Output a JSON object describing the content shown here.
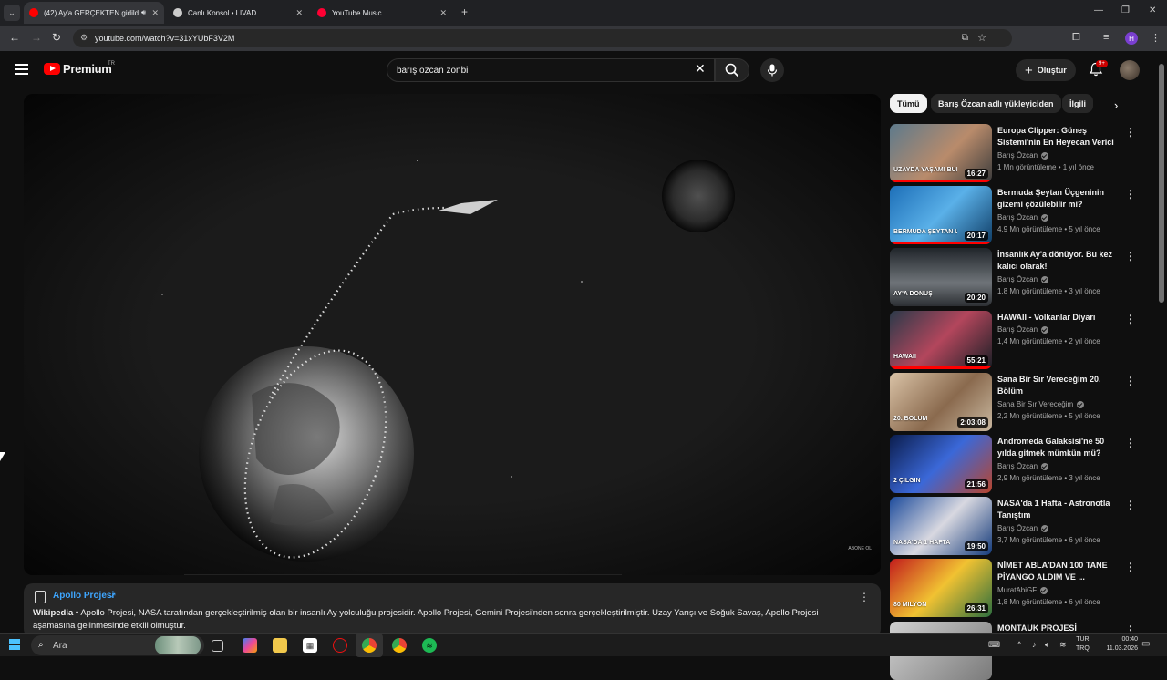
{
  "browser": {
    "tabs": [
      {
        "label": "(42) Ay'a GERÇEKTEN gidild",
        "active": true,
        "favicon_color": "#ff0000"
      },
      {
        "label": "Canlı Konsol • LIVAD",
        "active": false,
        "favicon_color": "#cccccc"
      },
      {
        "label": "YouTube Music",
        "active": false,
        "favicon_color": "#ff0033"
      }
    ],
    "url": "youtube.com/watch?v=31xYUbF3V2M"
  },
  "header": {
    "logo_text": "Premium",
    "country_code": "TR",
    "search_value": "barış özcan zonbi",
    "create_label": "Oluştur",
    "notification_badge": "9+"
  },
  "player": {
    "watermark": "ABONE OL"
  },
  "info_card": {
    "title": "Apollo Projesi",
    "source": "Wikipedia",
    "text": " • Apollo Projesi, NASA tarafından gerçekleştirilmiş olan bir insanlı Ay yolculuğu projesidir. Apollo Projesi, Gemini Projesi'nden sonra gerçekleştirilmiştir. Uzay Yarışı ve Soğuk Savaş, Apollo Projesi aşamasına gelinmesinde etkili olmuştur."
  },
  "chips": [
    "Tümü",
    "Barış Özcan adlı yükleyiciden",
    "İlgili"
  ],
  "recommendations": [
    {
      "title": "Europa Clipper: Güneş Sistemi'nin En Heyecan Verici ...",
      "channel": "Barış Özcan",
      "views": "1 Mn görüntüleme",
      "age": "1 yıl önce",
      "duration": "16:27",
      "verified": true,
      "progress": 1.0,
      "thumb_caption": "UZAYDA YAŞAMI BULMAYA GİDİYOR"
    },
    {
      "title": "Bermuda Şeytan Üçgeninin gizemi çözülebilir mi?",
      "channel": "Barış Özcan",
      "views": "4,9 Mn görüntüleme",
      "age": "5 yıl önce",
      "duration": "20:17",
      "verified": true,
      "progress": 1.0,
      "thumb_caption": "BERMUDA ŞEYTAN ÜÇGENİ"
    },
    {
      "title": "İnsanlık Ay'a dönüyor. Bu kez kalıcı olarak!",
      "channel": "Barış Özcan",
      "views": "1,8 Mn görüntüleme",
      "age": "3 yıl önce",
      "duration": "20:20",
      "verified": true,
      "progress": 0.0,
      "thumb_caption": "AY'A DÖNÜŞ"
    },
    {
      "title": "HAWAII - Volkanlar Diyarı",
      "channel": "Barış Özcan",
      "views": "1,4 Mn görüntüleme",
      "age": "2 yıl önce",
      "duration": "55:21",
      "verified": true,
      "progress": 1.0,
      "thumb_caption": "HAWAII"
    },
    {
      "title": "Sana Bir Sır Vereceğim 20. Bölüm",
      "channel": "Sana Bir Sır Vereceğim",
      "views": "2,2 Mn görüntüleme",
      "age": "5 yıl önce",
      "duration": "2:03:08",
      "verified": true,
      "progress": 0.0,
      "thumb_caption": "20. BÖLÜM"
    },
    {
      "title": "Andromeda Galaksisi'ne 50 yılda gitmek mümkün mü?",
      "channel": "Barış Özcan",
      "views": "2,9 Mn görüntüleme",
      "age": "3 yıl önce",
      "duration": "21:56",
      "verified": true,
      "progress": 0.0,
      "thumb_caption": "2 ÇILGIN"
    },
    {
      "title": "NASA'da 1 Hafta - Astronotla Tanıştım",
      "channel": "Barış Özcan",
      "views": "3,7 Mn görüntüleme",
      "age": "6 yıl önce",
      "duration": "19:50",
      "verified": true,
      "progress": 0.0,
      "thumb_caption": "NASA'DA 1 HAFTA"
    },
    {
      "title": "NİMET ABLA'DAN 100 TANE PİYANGO ALDIM VE ...",
      "channel": "MuratAbiGF",
      "views": "1,8 Mn görüntüleme",
      "age": "6 yıl önce",
      "duration": "26:31",
      "verified": true,
      "progress": 0.0,
      "thumb_caption": "80 MİLYON"
    },
    {
      "title": "MONTAUK PROJESİ",
      "channel": "",
      "views": "",
      "age": "",
      "duration": "",
      "verified": false,
      "progress": 0.0,
      "thumb_caption": ""
    }
  ],
  "taskbar": {
    "search_placeholder": "Ara",
    "lang_line1": "TUR",
    "lang_line2": "TRQ",
    "time": "00:40",
    "date": "11.03.2026"
  }
}
